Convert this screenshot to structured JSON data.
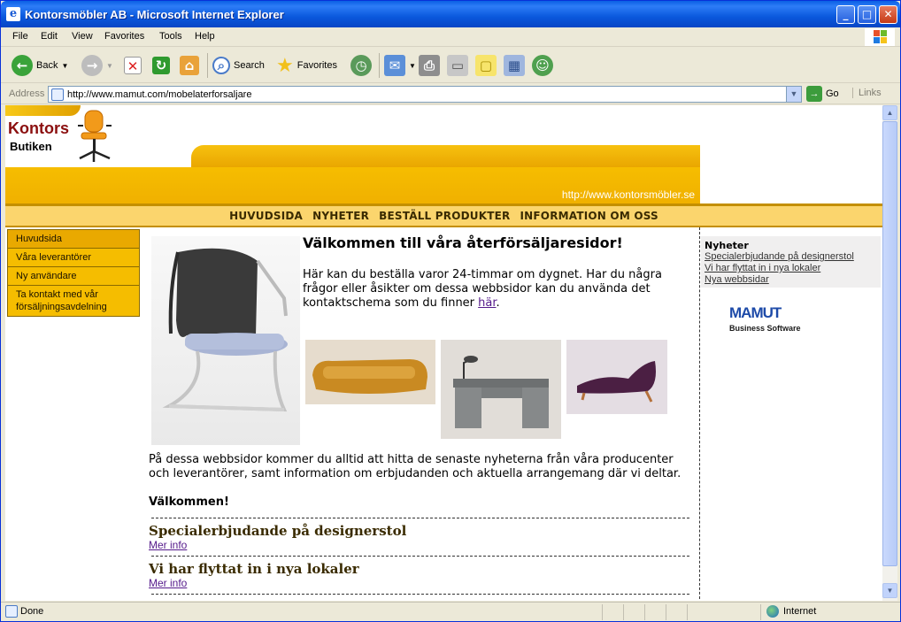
{
  "window": {
    "title": "Kontorsmöbler AB - Microsoft Internet Explorer"
  },
  "menu": [
    "File",
    "Edit",
    "View",
    "Favorites",
    "Tools",
    "Help"
  ],
  "toolbar": {
    "back": "Back",
    "search": "Search",
    "favorites": "Favorites"
  },
  "address": {
    "label": "Address",
    "url": "http://www.mamut.com/mobelaterforsaljare",
    "go": "Go",
    "links": "Links"
  },
  "status": {
    "text": "Done",
    "zone": "Internet"
  },
  "page": {
    "logo_line1": "Kontors",
    "logo_line2": "Butiken",
    "site_url": "http://www.kontorsmöbler.se",
    "nav": [
      "HUVUDSIDA",
      "NYHETER",
      "BESTÄLL PRODUKTER",
      "INFORMATION OM OSS"
    ],
    "sidenav": [
      "Huvudsida",
      "Våra leverantörer",
      "Ny användare",
      "Ta kontakt med vår försäljningsavdelning"
    ],
    "welcome": "Välkommen till våra återförsäljaresidor!",
    "intro": "Här kan du beställa varor 24-timmar om dygnet. Har du några frågor eller åsikter om dessa webbsidor kan du använda det kontaktschema som du finner ",
    "intro_link": "här",
    "body": "På dessa webbsidor kommer du alltid att hitta de senaste nyheterna från våra producenter och leverantörer, samt information om erbjudanden och aktuella arrangemang där vi deltar.",
    "valkommen": "Välkommen!",
    "items": [
      {
        "title": "Specialerbjudande på designerstol",
        "more": "Mer info"
      },
      {
        "title": "Vi har flyttat in i nya lokaler",
        "more": "Mer info"
      }
    ],
    "news": {
      "heading": "Nyheter",
      "links": [
        "Specialerbjudande på designerstol",
        "Vi har flyttat in i nya lokaler",
        "Nya webbsidar"
      ]
    },
    "mamut": {
      "name": "MAMUT",
      "sub": "Business Software"
    }
  }
}
